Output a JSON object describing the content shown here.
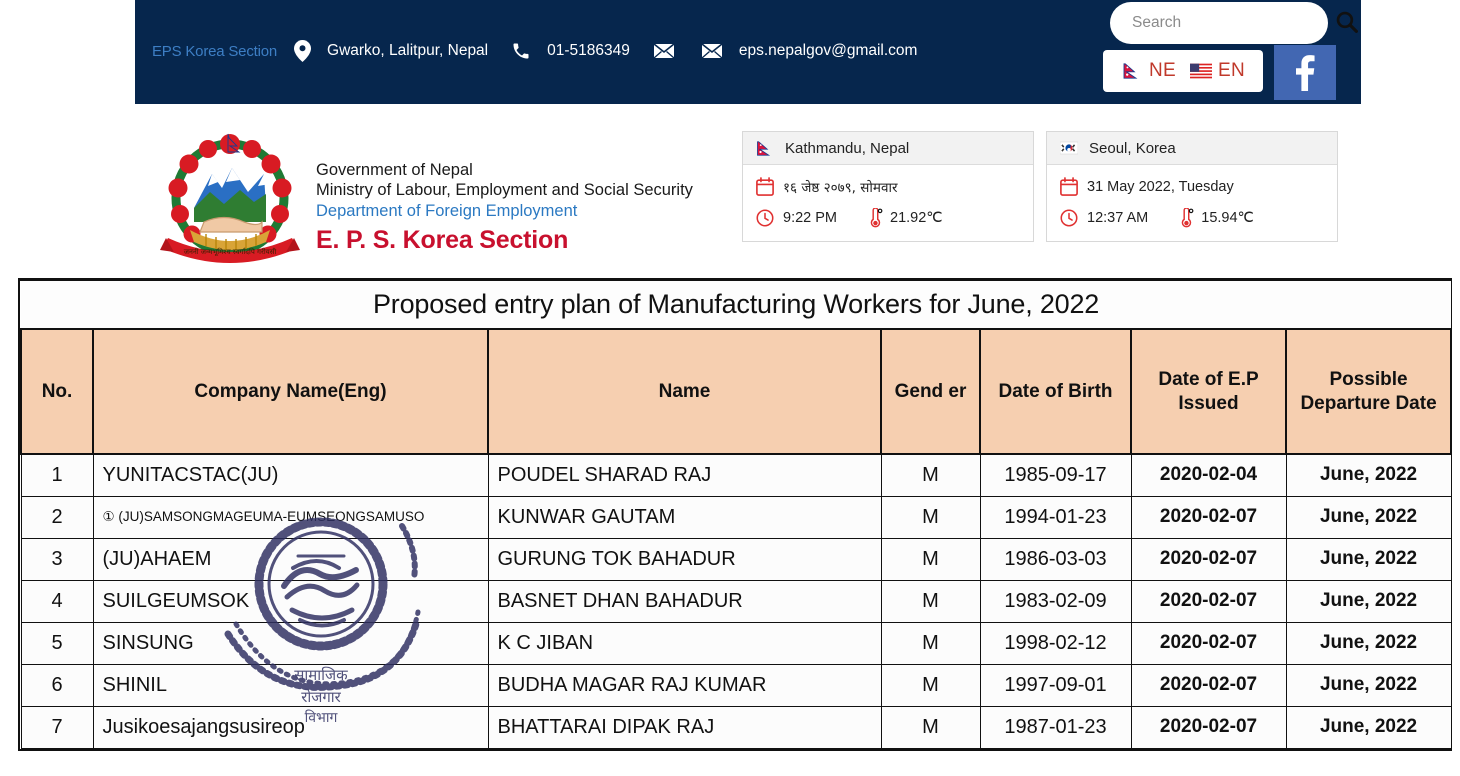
{
  "topbar": {
    "site_label": "EPS Korea Section",
    "address": "Gwarko, Lalitpur, Nepal",
    "phone": "01-5186349",
    "email": "eps.nepalgov@gmail.com",
    "search_placeholder": "Search",
    "search_value": "",
    "lang_ne": "NE",
    "lang_en": "EN",
    "facebook": "f"
  },
  "brand": {
    "line1": "Government of Nepal",
    "line2": "Ministry of Labour, Employment and Social Security",
    "line3": "Department of Foreign Employment",
    "line4": "E. P. S. Korea Section"
  },
  "panels": [
    {
      "title": "Kathmandu, Nepal",
      "flag": "nepal-flag-icon",
      "date": "१६ जेष्ठ २०७९, सोमवार",
      "time": "9:22 PM",
      "temperature": "21.92℃"
    },
    {
      "title": "Seoul, Korea",
      "flag": "korea-flag-icon",
      "date": "31 May 2022, Tuesday",
      "time": "12:37 AM",
      "temperature": "15.94℃"
    }
  ],
  "table": {
    "title": "Proposed entry plan of Manufacturing Workers for June, 2022",
    "headers": [
      "No.",
      "Company Name(Eng)",
      "Name",
      "Gend er",
      "Date of Birth",
      "Date of E.P Issued",
      "Possible Departure Date"
    ],
    "rows": [
      {
        "no": "1",
        "company": "YUNITACSTAC(JU)",
        "name": "POUDEL SHARAD RAJ",
        "gender": "M",
        "dob": "1985-09-17",
        "ep": "2020-02-04",
        "departure": "June, 2022"
      },
      {
        "no": "2",
        "company": "① (JU)SAMSONGMAGEUMA-EUMSEONGSAMUSO",
        "name": "KUNWAR GAUTAM",
        "gender": "M",
        "dob": "1994-01-23",
        "ep": "2020-02-07",
        "departure": "June, 2022"
      },
      {
        "no": "3",
        "company": "(JU)AHAEM",
        "name": "GURUNG TOK BAHADUR",
        "gender": "M",
        "dob": "1986-03-03",
        "ep": "2020-02-07",
        "departure": "June, 2022"
      },
      {
        "no": "4",
        "company": "SUILGEUMSOK",
        "name": "BASNET DHAN BAHADUR",
        "gender": "M",
        "dob": "1983-02-09",
        "ep": "2020-02-07",
        "departure": "June, 2022"
      },
      {
        "no": "5",
        "company": "SINSUNG",
        "name": "K C JIBAN",
        "gender": "M",
        "dob": "1998-02-12",
        "ep": "2020-02-07",
        "departure": "June, 2022"
      },
      {
        "no": "6",
        "company": "SHINIL",
        "name": "BUDHA MAGAR RAJ KUMAR",
        "gender": "M",
        "dob": "1997-09-01",
        "ep": "2020-02-07",
        "departure": "June, 2022"
      },
      {
        "no": "7",
        "company": "Jusikoesajangsusireop",
        "name": "BHATTARAI DIPAK RAJ",
        "gender": "M",
        "dob": "1987-01-23",
        "ep": "2020-02-07",
        "departure": "June, 2022"
      }
    ]
  },
  "stamp": {
    "name": "official-seal-stamp",
    "color": "#2f3061"
  },
  "colors": {
    "navy": "#06264d",
    "header_peach": "#f6cfb0",
    "brand_red": "#c8102e",
    "brand_blue": "#2b79c2",
    "facebook_blue": "#4267b2"
  }
}
